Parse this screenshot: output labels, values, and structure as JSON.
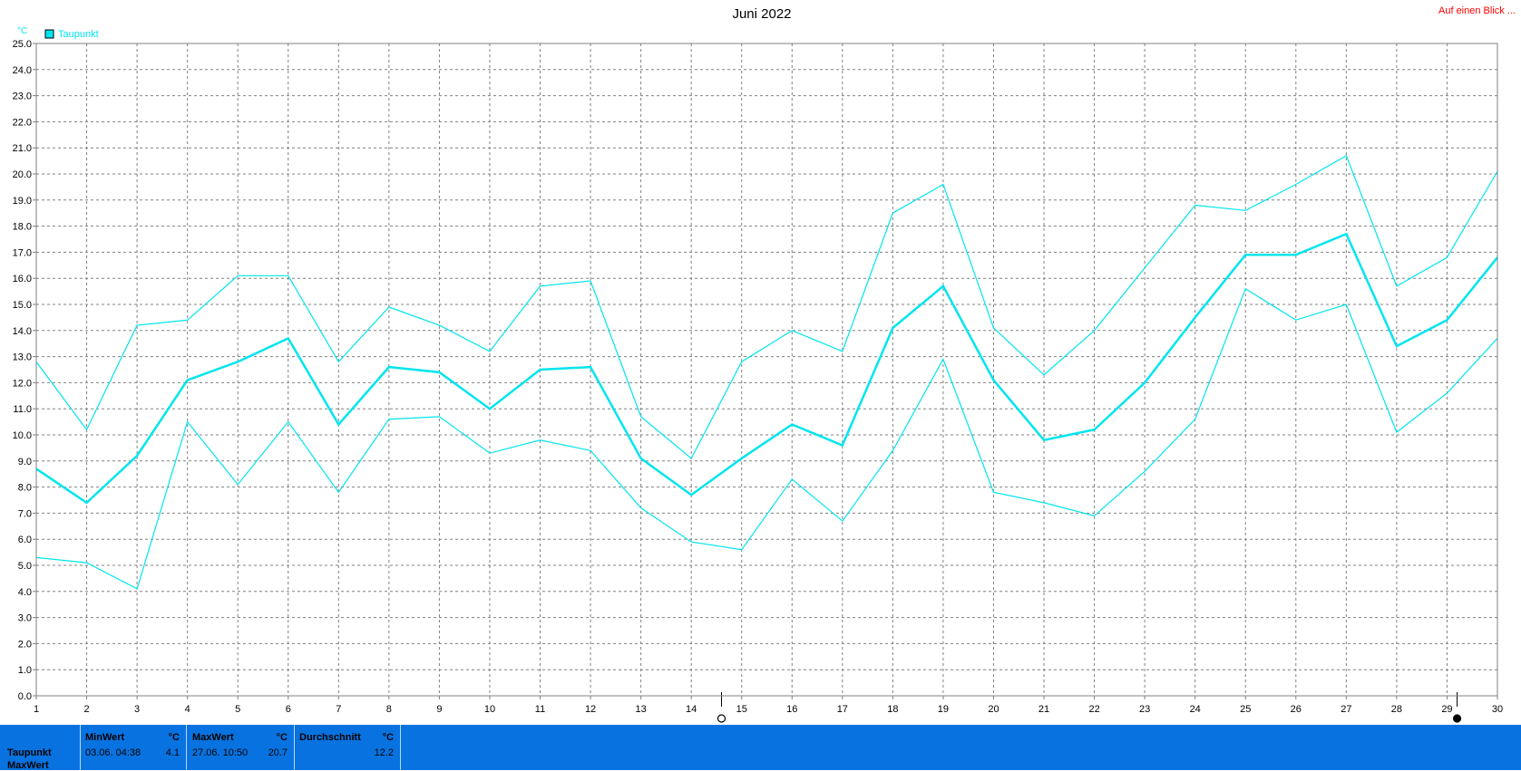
{
  "header": {
    "title": "Juni 2022",
    "link_label": "Auf einen Blick ..."
  },
  "chart_data": {
    "type": "line",
    "title": "Juni 2022",
    "ylabel": "°C",
    "ylim": [
      0,
      25
    ],
    "xlim": [
      1,
      30
    ],
    "y_ticks": [
      "0.0",
      "1.0",
      "2.0",
      "3.0",
      "4.0",
      "5.0",
      "6.0",
      "7.0",
      "8.0",
      "9.0",
      "10.0",
      "11.0",
      "12.0",
      "13.0",
      "14.0",
      "15.0",
      "16.0",
      "17.0",
      "18.0",
      "19.0",
      "20.0",
      "21.0",
      "22.0",
      "23.0",
      "24.0",
      "25.0"
    ],
    "x": [
      1,
      2,
      3,
      4,
      5,
      6,
      7,
      8,
      9,
      10,
      11,
      12,
      13,
      14,
      15,
      16,
      17,
      18,
      19,
      20,
      21,
      22,
      23,
      24,
      25,
      26,
      27,
      28,
      29,
      30
    ],
    "grid": true,
    "legend": {
      "placement": "top-left",
      "entries": [
        "Taupunkt"
      ]
    },
    "series": [
      {
        "name": "Taupunkt",
        "color": "#00e5ee",
        "values": [
          8.7,
          7.4,
          9.2,
          12.1,
          12.8,
          13.7,
          10.4,
          12.6,
          12.4,
          11.0,
          12.5,
          12.6,
          9.1,
          7.7,
          9.1,
          10.4,
          9.6,
          14.1,
          15.7,
          12.1,
          9.8,
          10.2,
          12.0,
          14.5,
          16.9,
          16.9,
          17.7,
          13.4,
          14.4,
          16.8
        ]
      },
      {
        "color": "#00e5ee",
        "values": [
          12.8,
          10.2,
          14.2,
          14.4,
          16.1,
          16.1,
          12.8,
          14.9,
          14.2,
          13.2,
          15.7,
          15.9,
          10.7,
          9.1,
          12.8,
          14.0,
          13.2,
          18.5,
          19.6,
          14.1,
          12.3,
          14.0,
          16.4,
          18.8,
          18.6,
          19.6,
          20.7,
          15.7,
          16.8,
          20.1
        ]
      },
      {
        "color": "#00e5ee",
        "values": [
          5.3,
          5.1,
          4.1,
          10.5,
          8.1,
          10.5,
          7.8,
          10.6,
          10.7,
          9.3,
          9.8,
          9.4,
          7.2,
          5.9,
          5.6,
          8.3,
          6.7,
          9.4,
          12.9,
          7.8,
          7.4,
          6.9,
          8.6,
          10.6,
          15.6,
          14.4,
          15.0,
          10.1,
          11.6,
          13.7
        ]
      }
    ],
    "markers": [
      {
        "position": 14.6,
        "icon": "new-moon-icon"
      },
      {
        "position": 29.2,
        "icon": "full-moon-icon"
      }
    ]
  },
  "stats_table": {
    "row_labels": [
      "Taupunkt",
      "MaxWert"
    ],
    "min": {
      "header": "MinWert",
      "unit": "°C",
      "date_time": "03.06.  04:38",
      "value": "4.1"
    },
    "max": {
      "header": "MaxWert",
      "unit": "°C",
      "date_time": "27.06.  10:50",
      "value": "20.7"
    },
    "avg": {
      "header": "Durchschnitt",
      "unit": "°C",
      "value": "12.2"
    }
  }
}
